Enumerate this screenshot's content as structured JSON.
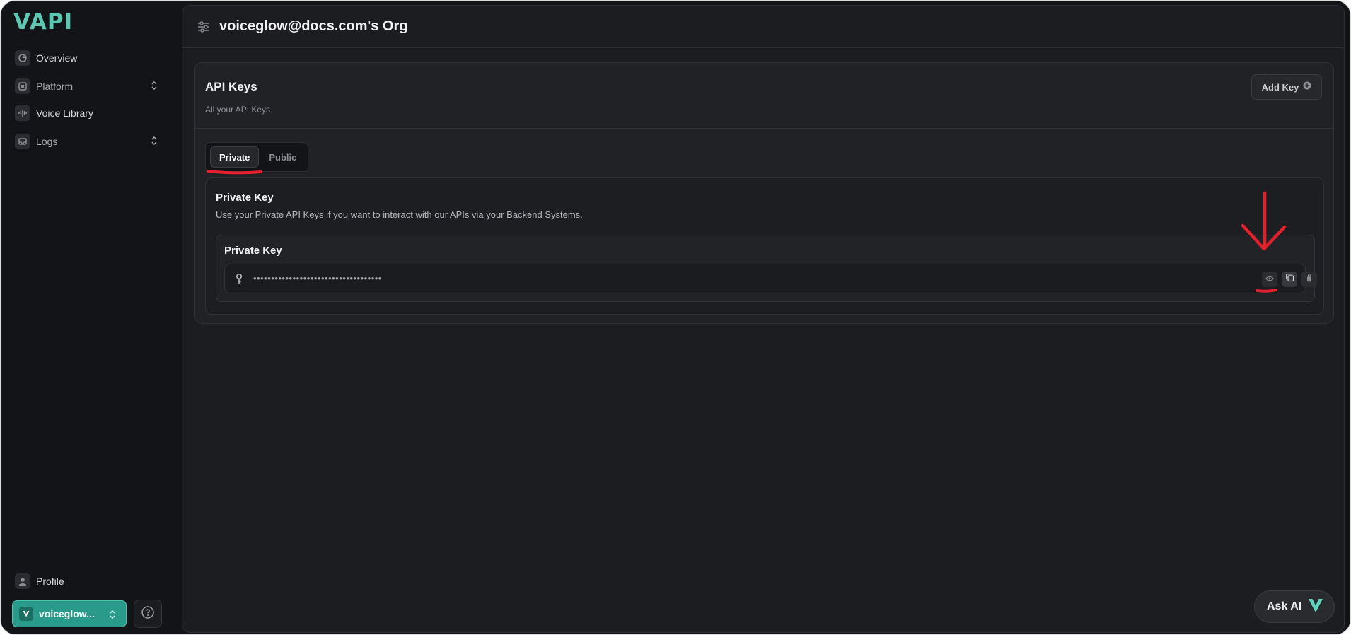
{
  "app": {
    "logo_text": "VAPI",
    "org_title": "voiceglow@docs.com's Org"
  },
  "sidebar": {
    "items": [
      {
        "label": "Overview",
        "icon": "pie-chart-icon"
      },
      {
        "label": "Platform",
        "icon": "platform-icon"
      },
      {
        "label": "Voice Library",
        "icon": "waveform-icon"
      },
      {
        "label": "Logs",
        "icon": "inbox-icon"
      }
    ],
    "profile_label": "Profile",
    "org_switcher_label": "voiceglow...",
    "help_icon": "help-circle-icon"
  },
  "card": {
    "title": "API Keys",
    "subtitle": "All your API Keys",
    "add_key_label": "Add Key"
  },
  "tabs": [
    {
      "label": "Private",
      "active": true
    },
    {
      "label": "Public",
      "active": false
    }
  ],
  "private_section": {
    "title": "Private Key",
    "description": "Use your Private API Keys if you want to interact with our APIs via your Backend Systems.",
    "key_label": "Private Key",
    "key_value": "••••••••••••••••••••••••••••••••••••",
    "actions": [
      "eye-icon",
      "copy-icon",
      "trash-icon"
    ]
  },
  "ask_ai": {
    "label": "Ask AI"
  },
  "colors": {
    "accent": "#5dc7b1",
    "org_button": "#2a9a8b",
    "annotation": "#e3202b",
    "background": "#131417",
    "panel": "#1c1d21"
  }
}
